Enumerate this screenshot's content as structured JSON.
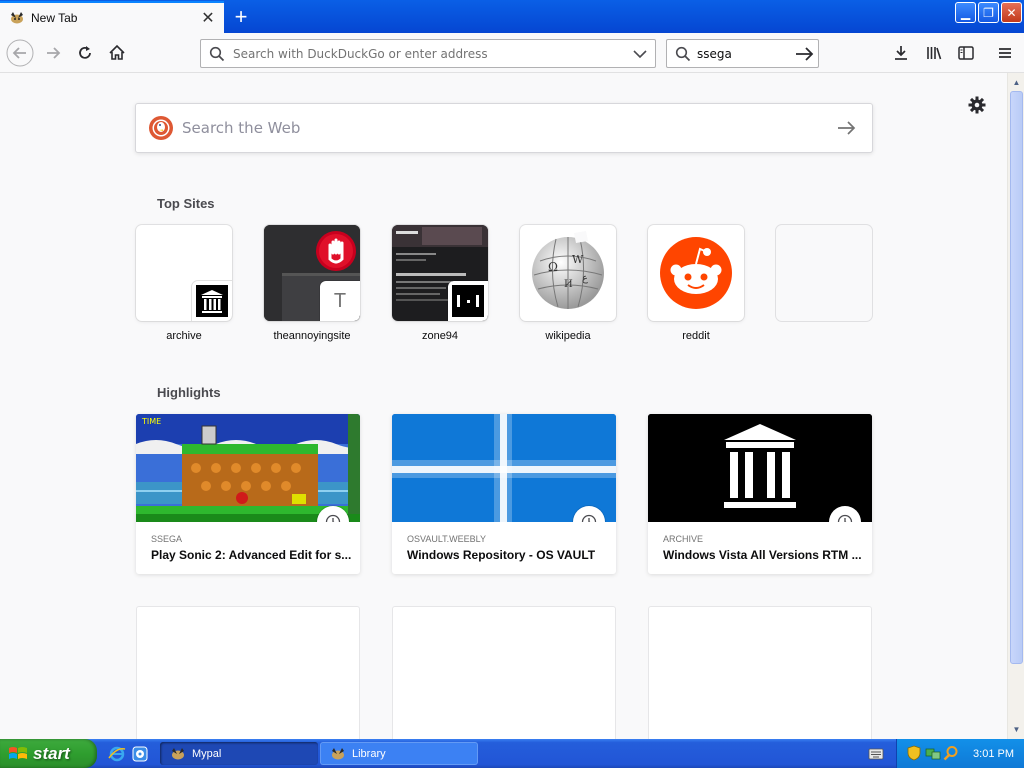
{
  "browser": {
    "tab": {
      "title": "New Tab"
    },
    "urlbar": {
      "placeholder": "Search with DuckDuckGo or enter address",
      "value": ""
    },
    "searchbar": {
      "value": "ssega"
    }
  },
  "newtab": {
    "websearch": {
      "placeholder": "Search the Web"
    },
    "top_sites_title": "Top Sites",
    "top_sites": [
      {
        "label": "archive"
      },
      {
        "label": "theannoyingsite",
        "mini_letter": "T"
      },
      {
        "label": "zone94"
      },
      {
        "label": "wikipedia"
      },
      {
        "label": "reddit"
      },
      {
        "label": ""
      }
    ],
    "highlights_title": "Highlights",
    "highlights": [
      {
        "source": "SSEGA",
        "title": "Play Sonic 2: Advanced Edit for s..."
      },
      {
        "source": "OSVAULT.WEEBLY",
        "title": "Windows Repository - OS VAULT"
      },
      {
        "source": "ARCHIVE",
        "title": "Windows Vista All Versions RTM ..."
      }
    ]
  },
  "taskbar": {
    "start_label": "start",
    "tasks": [
      {
        "label": "Mypal"
      },
      {
        "label": "Library"
      }
    ],
    "clock": "3:01 PM"
  },
  "colors": {
    "accent": "#0a84ff",
    "reddit": "#ff4500",
    "xp_blue": "#245edb",
    "xp_green": "#2f9e2f"
  }
}
